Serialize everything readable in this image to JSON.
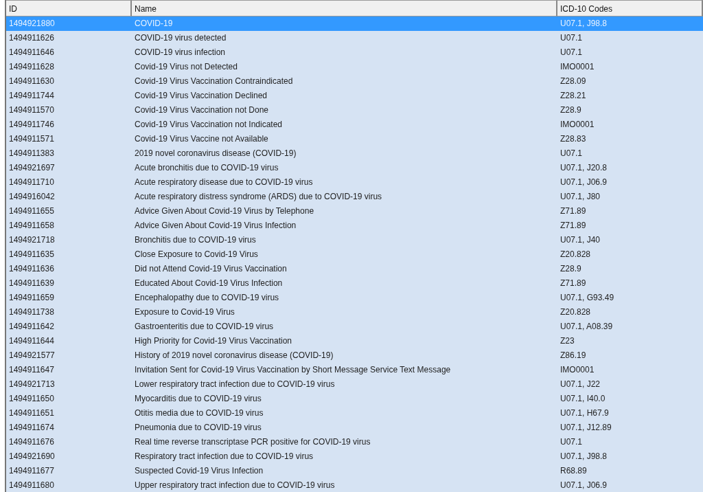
{
  "table": {
    "columns": [
      "ID",
      "Name",
      "ICD-10 Codes"
    ],
    "rows": [
      {
        "id": "1494921880",
        "name": "COVID-19",
        "codes": "U07.1, J98.8",
        "selected": true
      },
      {
        "id": "1494911626",
        "name": "COVID-19 virus detected",
        "codes": "U07.1",
        "selected": false
      },
      {
        "id": "1494911646",
        "name": "COVID-19 virus infection",
        "codes": "U07.1",
        "selected": false
      },
      {
        "id": "1494911628",
        "name": "Covid-19 Virus not Detected",
        "codes": "IMO0001",
        "selected": false
      },
      {
        "id": "1494911630",
        "name": "Covid-19 Virus Vaccination Contraindicated",
        "codes": "Z28.09",
        "selected": false
      },
      {
        "id": "1494911744",
        "name": "Covid-19 Virus Vaccination Declined",
        "codes": "Z28.21",
        "selected": false
      },
      {
        "id": "1494911570",
        "name": "Covid-19 Virus Vaccination not Done",
        "codes": "Z28.9",
        "selected": false
      },
      {
        "id": "1494911746",
        "name": "Covid-19 Virus Vaccination not Indicated",
        "codes": "IMO0001",
        "selected": false
      },
      {
        "id": "1494911571",
        "name": "Covid-19 Virus Vaccine not Available",
        "codes": "Z28.83",
        "selected": false
      },
      {
        "id": "1494911383",
        "name": "2019 novel coronavirus disease (COVID-19)",
        "codes": "U07.1",
        "selected": false
      },
      {
        "id": "1494921697",
        "name": "Acute bronchitis due to COVID-19 virus",
        "codes": "U07.1, J20.8",
        "selected": false
      },
      {
        "id": "1494911710",
        "name": "Acute respiratory disease due to COVID-19 virus",
        "codes": "U07.1, J06.9",
        "selected": false
      },
      {
        "id": "1494916042",
        "name": "Acute respiratory distress syndrome (ARDS) due to COVID-19 virus",
        "codes": "U07.1, J80",
        "selected": false
      },
      {
        "id": "1494911655",
        "name": "Advice Given About Covid-19 Virus by Telephone",
        "codes": "Z71.89",
        "selected": false
      },
      {
        "id": "1494911658",
        "name": "Advice Given About Covid-19 Virus Infection",
        "codes": "Z71.89",
        "selected": false
      },
      {
        "id": "1494921718",
        "name": "Bronchitis due to COVID-19 virus",
        "codes": "U07.1, J40",
        "selected": false
      },
      {
        "id": "1494911635",
        "name": "Close Exposure to Covid-19 Virus",
        "codes": "Z20.828",
        "selected": false
      },
      {
        "id": "1494911636",
        "name": "Did not Attend Covid-19 Virus Vaccination",
        "codes": "Z28.9",
        "selected": false
      },
      {
        "id": "1494911639",
        "name": "Educated About Covid-19 Virus Infection",
        "codes": "Z71.89",
        "selected": false
      },
      {
        "id": "1494911659",
        "name": "Encephalopathy due to COVID-19 virus",
        "codes": "U07.1, G93.49",
        "selected": false
      },
      {
        "id": "1494911738",
        "name": "Exposure to Covid-19 Virus",
        "codes": "Z20.828",
        "selected": false
      },
      {
        "id": "1494911642",
        "name": "Gastroenteritis due to COVID-19 virus",
        "codes": "U07.1, A08.39",
        "selected": false
      },
      {
        "id": "1494911644",
        "name": "High Priority for Covid-19 Virus Vaccination",
        "codes": "Z23",
        "selected": false
      },
      {
        "id": "1494921577",
        "name": "History of 2019 novel coronavirus disease (COVID-19)",
        "codes": "Z86.19",
        "selected": false
      },
      {
        "id": "1494911647",
        "name": "Invitation Sent for Covid-19 Virus Vaccination by Short Message Service Text Message",
        "codes": "IMO0001",
        "selected": false
      },
      {
        "id": "1494921713",
        "name": "Lower respiratory tract infection due to COVID-19 virus",
        "codes": "U07.1, J22",
        "selected": false
      },
      {
        "id": "1494911650",
        "name": "Myocarditis due to COVID-19 virus",
        "codes": "U07.1, I40.0",
        "selected": false
      },
      {
        "id": "1494911651",
        "name": "Otitis media due to COVID-19 virus",
        "codes": "U07.1, H67.9",
        "selected": false
      },
      {
        "id": "1494911674",
        "name": "Pneumonia due to COVID-19 virus",
        "codes": "U07.1, J12.89",
        "selected": false
      },
      {
        "id": "1494911676",
        "name": "Real time reverse transcriptase PCR positive for COVID-19 virus",
        "codes": "U07.1",
        "selected": false
      },
      {
        "id": "1494921690",
        "name": "Respiratory tract infection due to COVID-19 virus",
        "codes": "U07.1, J98.8",
        "selected": false
      },
      {
        "id": "1494911677",
        "name": "Suspected Covid-19 Virus Infection",
        "codes": "R68.89",
        "selected": false
      },
      {
        "id": "1494911680",
        "name": "Upper respiratory tract infection due to COVID-19 virus",
        "codes": "U07.1, J06.9",
        "selected": false
      }
    ]
  }
}
